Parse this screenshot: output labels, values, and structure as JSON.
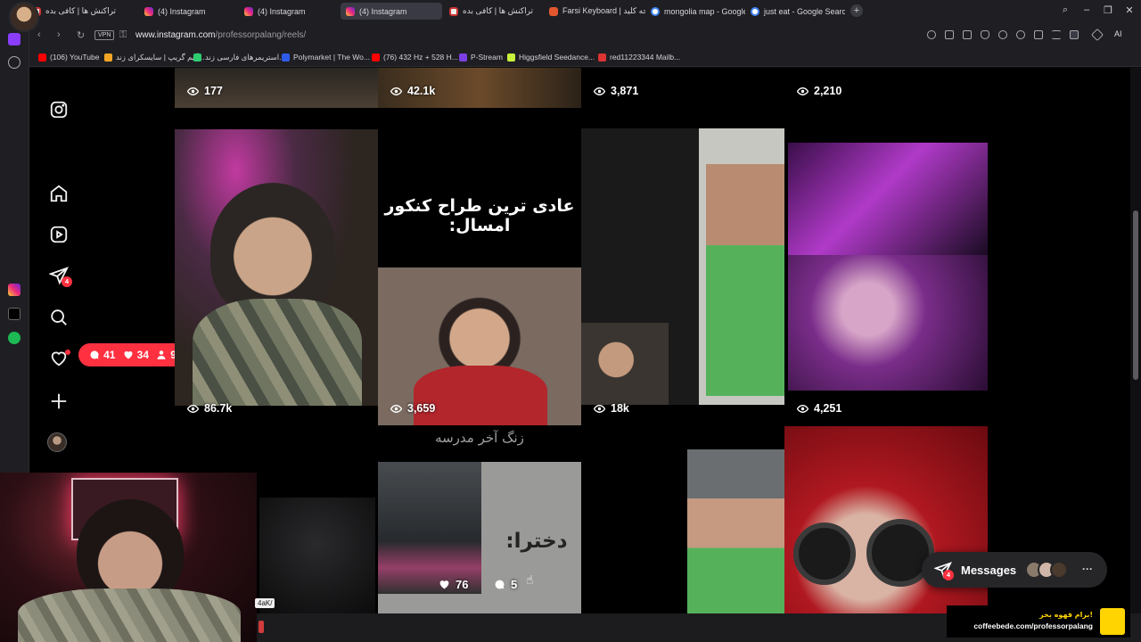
{
  "browser": {
    "tabs": [
      {
        "title": "تراکنش ها | کافی بده",
        "icon": "doc"
      },
      {
        "title": "(4) Instagram",
        "icon": "insta"
      },
      {
        "title": "(4) Instagram",
        "icon": "insta"
      },
      {
        "title": "(4) Instagram",
        "icon": "insta",
        "active": true
      },
      {
        "title": "تراکنش ها | کافی بده",
        "icon": "doc"
      },
      {
        "title": "Farsi Keyboard | صفحه کلید",
        "icon": "kb"
      },
      {
        "title": "mongolia map - Google S",
        "icon": "ggl"
      },
      {
        "title": "just eat - Google Search",
        "icon": "ggl"
      }
    ],
    "new_tab": "+",
    "vpn_label": "VPN",
    "url_host": "www.instagram.com",
    "url_path": "/professorpalang/reels/",
    "ai_label": "AI",
    "bookmarks": [
      {
        "label": "(106) YouTube",
        "color": "#ff0000"
      },
      {
        "label": "گیم گریپ | سایسکرای زند...",
        "color": "#f5a623"
      },
      {
        "label": "استریمرهای فارسی زند...",
        "color": "#2ecc71"
      },
      {
        "label": "Polymarket | The Wo...",
        "color": "#2f5bea"
      },
      {
        "label": "(76) 432 Hz + 528 H...",
        "color": "#ff0000"
      },
      {
        "label": "P-Stream",
        "color": "#7b3fe4"
      },
      {
        "label": "Higgsfield Seedance...",
        "color": "#c9f23a"
      },
      {
        "label": "red11223344 Mailb...",
        "color": "#d33"
      }
    ]
  },
  "instagram": {
    "dm_badge": "4",
    "notifications": {
      "comments": "41",
      "likes": "34",
      "follows": "9"
    },
    "top_row_views": [
      "177",
      "42.1k",
      "3,871",
      "2,210"
    ],
    "reels_row2": [
      {
        "views": "86.7k"
      },
      {
        "views": "3,659",
        "caption": "عادی ترین طراح کنکور امسال:"
      },
      {
        "views": "18k"
      },
      {
        "views": "4,251"
      }
    ],
    "reels_row3": [
      {},
      {
        "caption_top": "زنگ آخر مدرسه",
        "caption_side": "دخترا:",
        "hover_likes": "76",
        "hover_comments": "5"
      },
      {},
      {}
    ],
    "messages_label": "Messages",
    "messages_badge": "4",
    "messages_more": "···"
  },
  "stream_overlay": {
    "mini_label": "4aK/",
    "coffee_line1": "برام قهوه بخر!",
    "coffee_line2": "coffeebede.com/professorpalang"
  },
  "colors": {
    "accent_red": "#ff3040",
    "coffee_yellow": "#ffd400"
  }
}
